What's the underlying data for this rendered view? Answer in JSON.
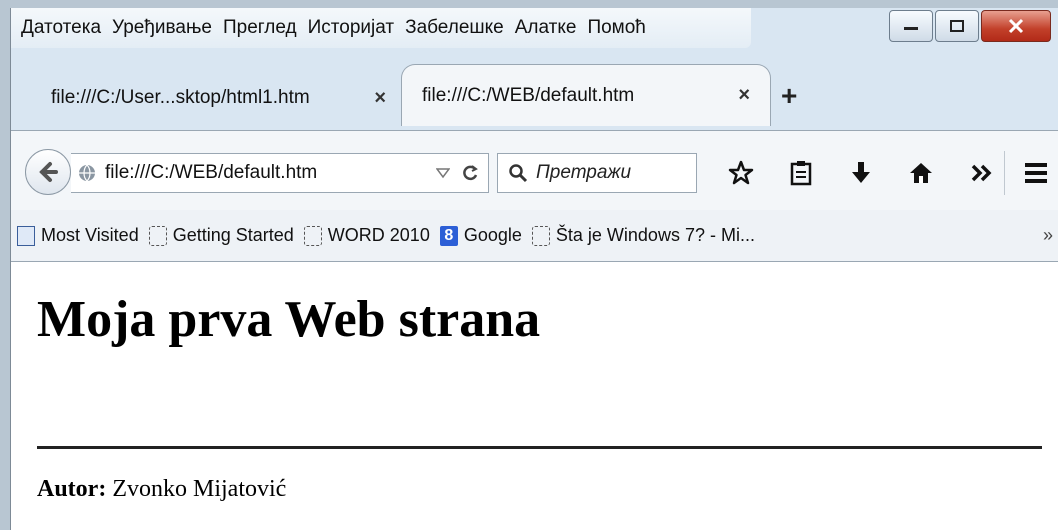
{
  "menu": {
    "items": [
      "Датотека",
      "Уређивање",
      "Преглед",
      "Историјат",
      "Забелешке",
      "Алатке",
      "Помоћ"
    ]
  },
  "tabs": [
    {
      "label": "file:///C:/User...sktop/html1.htm",
      "active": false
    },
    {
      "label": "file:///C:/WEB/default.htm",
      "active": true
    }
  ],
  "tab_close_glyph": "×",
  "new_tab_glyph": "+",
  "navbar": {
    "url": "file:///C:/WEB/default.htm",
    "search_placeholder": "Претражи"
  },
  "bookmarks": [
    {
      "label": "Most Visited",
      "icon": "most-visited-icon"
    },
    {
      "label": "Getting Started",
      "icon": "page-icon"
    },
    {
      "label": "WORD 2010",
      "icon": "page-icon"
    },
    {
      "label": "Google",
      "icon": "google-icon"
    },
    {
      "label": "Šta je Windows 7? - Mi...",
      "icon": "page-icon"
    }
  ],
  "content": {
    "title": "Moja prva Web strana",
    "author_label": "Autor:",
    "author_name": "Zvonko Mijatović"
  },
  "colors": {
    "chrome": "#d9e6f2",
    "close_button": "#c2402a",
    "google_icon": "#2c5fd6"
  }
}
